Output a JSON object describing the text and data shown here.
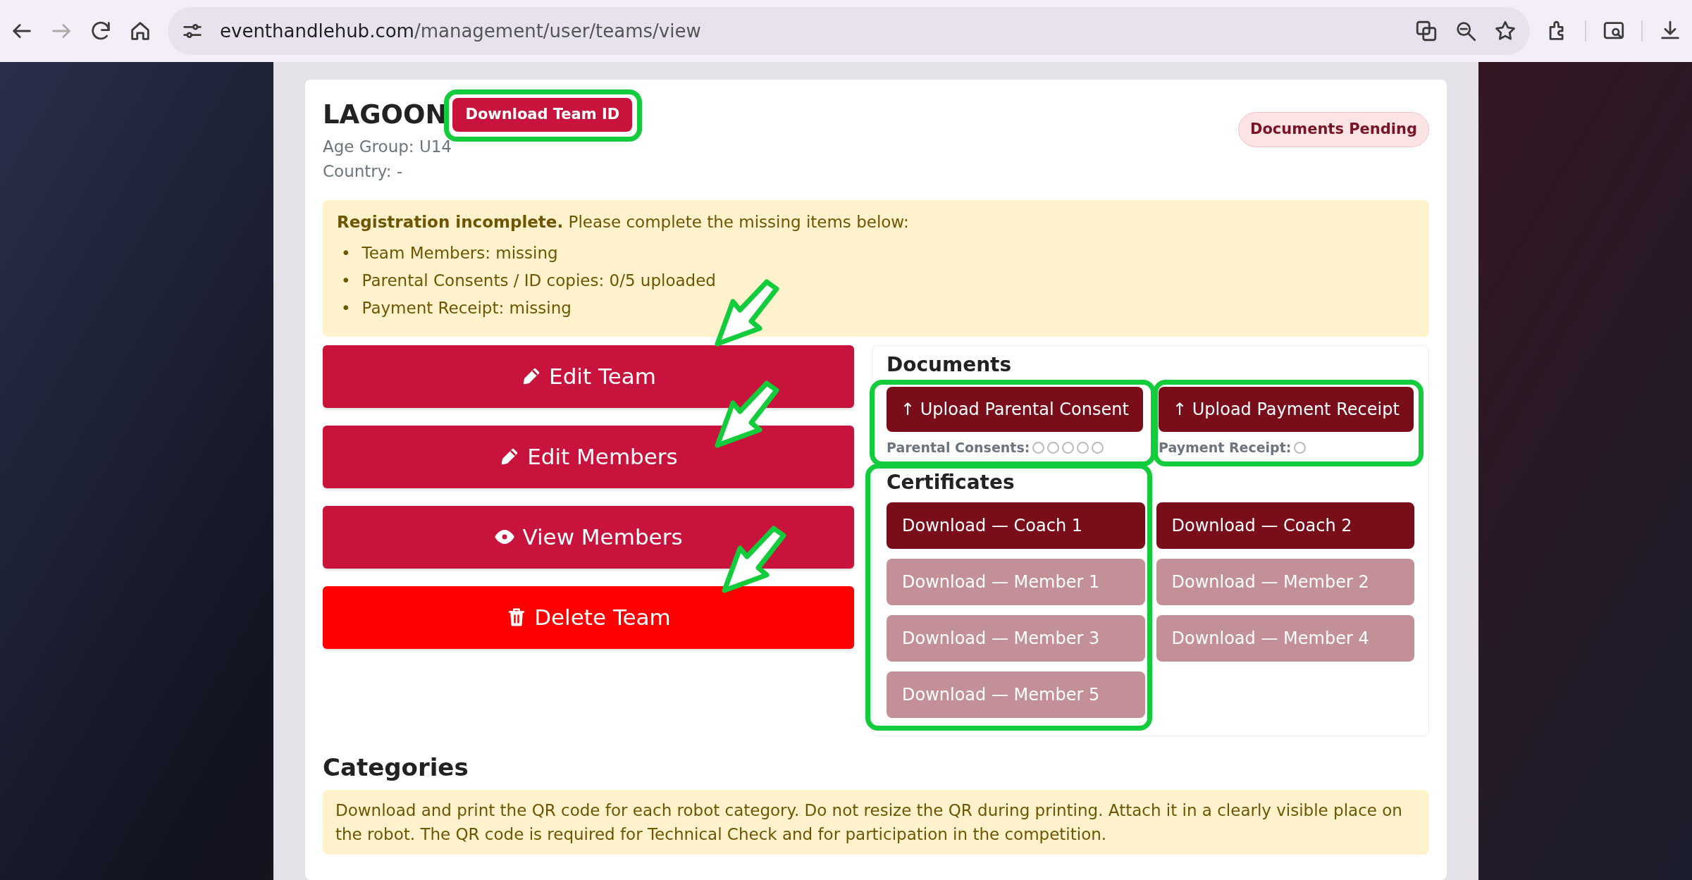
{
  "browser": {
    "url_host": "eventhandlehub.com",
    "url_path": "/management/user/teams/view"
  },
  "team": {
    "name": "LAGOON",
    "download_button": "Download Team ID",
    "age_group": "Age Group: U14",
    "country": "Country: -",
    "status": "Documents Pending"
  },
  "alert": {
    "message": "**Registration incomplete.** Please complete the missing items below:",
    "items": [
      {
        "bullet": "•",
        "text": "Team Members: missing"
      },
      {
        "bullet": "•",
        "text": "Parental Consents / ID copies: 0/5 uploaded"
      },
      {
        "bullet": "•",
        "text": "Payment Receipt: missing"
      }
    ]
  },
  "actions": [
    {
      "label": "Edit Team",
      "kind": "edit"
    },
    {
      "label": "Edit Members",
      "kind": "edit"
    },
    {
      "label": "View Members",
      "kind": "view"
    },
    {
      "label": "Delete Team",
      "kind": "delete"
    }
  ],
  "documents": {
    "heading": "Documents",
    "uploads": [
      {
        "button": "↑ Upload Parental Consent",
        "status_label": "Parental Consents:",
        "slots": [
          {
            "uploaded": false
          },
          {
            "uploaded": false
          },
          {
            "uploaded": false
          },
          {
            "uploaded": false
          },
          {
            "uploaded": false
          }
        ]
      },
      {
        "button": "↑ Upload Payment Receipt",
        "status_label": "Payment Receipt:",
        "slots": [
          {
            "uploaded": false
          }
        ]
      }
    ]
  },
  "certificates": {
    "heading": "Certificates",
    "items": [
      {
        "label": "Download — Coach 1",
        "disabled": false
      },
      {
        "label": "Download — Coach 2",
        "disabled": false
      },
      {
        "label": "Download — Member 1",
        "disabled": true
      },
      {
        "label": "Download — Member 2",
        "disabled": true
      },
      {
        "label": "Download — Member 3",
        "disabled": true
      },
      {
        "label": "Download — Member 4",
        "disabled": true
      },
      {
        "label": "Download — Member 5",
        "disabled": true
      }
    ]
  },
  "categories": {
    "heading": "Categories",
    "note": "Download and print the QR code for each robot category. Do not resize the QR during printing. Attach it in a clearly visible place on the robot. The QR code is required for Technical Check and for participation in the competition."
  }
}
